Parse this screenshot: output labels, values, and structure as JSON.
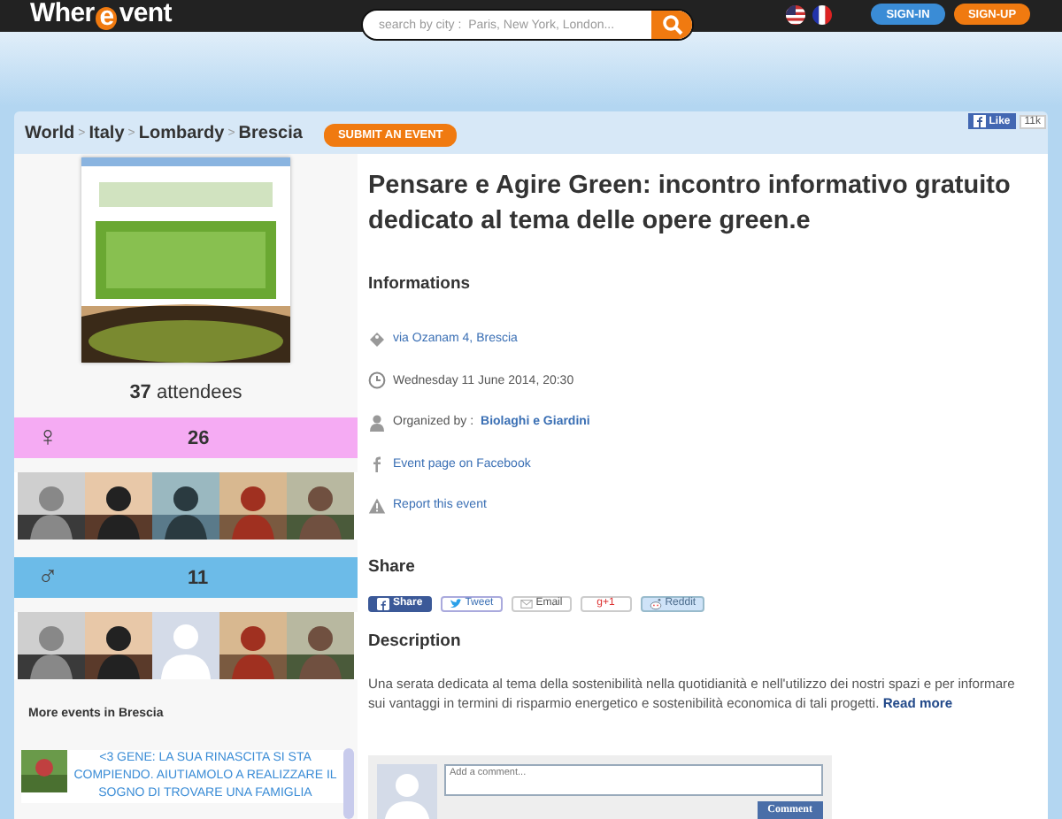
{
  "header": {
    "logo": [
      "Wher",
      "e",
      "vent"
    ],
    "search": {
      "placeholder": "search by city :  Paris, New York, London..."
    },
    "buttons": [
      {
        "label": "SIGN-IN",
        "kind": "primary"
      },
      {
        "label": "SIGN-UP",
        "kind": "accent"
      }
    ]
  },
  "breadcrumb": {
    "items": [
      "World",
      "Italy",
      "Lombardy",
      "Brescia"
    ],
    "separator": ">"
  },
  "submit_button": "SUBMIT AN EVENT",
  "like": {
    "label": "Like",
    "count": "11k"
  },
  "sidebar": {
    "attendees": {
      "count": "37",
      "label": "attendees"
    },
    "groups": [
      {
        "kind": "female",
        "symbol": "♀",
        "count": "26",
        "avatars": [
          {
            "kind": "picture"
          },
          {
            "kind": "picture"
          },
          {
            "kind": "picture"
          },
          {
            "kind": "picture"
          },
          {
            "kind": "picture"
          }
        ]
      },
      {
        "kind": "male",
        "symbol": "♂",
        "count": "11",
        "avatars": [
          {
            "kind": "picture"
          },
          {
            "kind": "picture"
          },
          {
            "kind": "silhouette"
          },
          {
            "kind": "picture"
          },
          {
            "kind": "picture"
          }
        ]
      }
    ],
    "more_events": {
      "title": "More events in Brescia",
      "items": [
        {
          "text": "<3 GENE: LA SUA RINASCITA SI STA COMPIENDO. AIUTIAMOLO A REALIZZARE IL SOGNO DI TROVARE UNA FAMIGLIA"
        }
      ]
    }
  },
  "event": {
    "title": "Pensare e Agire Green: incontro informativo gratuito dedicato al tema delle opere green.e",
    "info_heading": "Informations",
    "info": [
      {
        "kind": "address",
        "link": "via Ozanam 4, Brescia"
      },
      {
        "kind": "date",
        "text": "Wednesday 11 June 2014, 20:30"
      },
      {
        "kind": "organizer",
        "text": "Organized by :",
        "link": "Biolaghi e Giardini"
      },
      {
        "kind": "facebook",
        "link": "Event page on Facebook"
      },
      {
        "kind": "report",
        "link": "Report this event"
      }
    ],
    "share_heading": "Share",
    "share": [
      {
        "kind": "facebook",
        "label": "Share"
      },
      {
        "kind": "twitter",
        "label": "Tweet"
      },
      {
        "kind": "email",
        "label": "Email"
      },
      {
        "kind": "gplus",
        "label": "g+1"
      },
      {
        "kind": "reddit",
        "label": "Reddit"
      }
    ],
    "description_heading": "Description",
    "description": "Una serata dedicata al tema della sostenibilità nella quotidianità e nell'utilizzo dei nostri spazi e per informare sui vantaggi in termini di risparmio energetico e sostenibilità economica di tali progetti.",
    "read_more": "Read more",
    "comment": {
      "placeholder": "Add a comment...",
      "button": "Comment"
    }
  }
}
